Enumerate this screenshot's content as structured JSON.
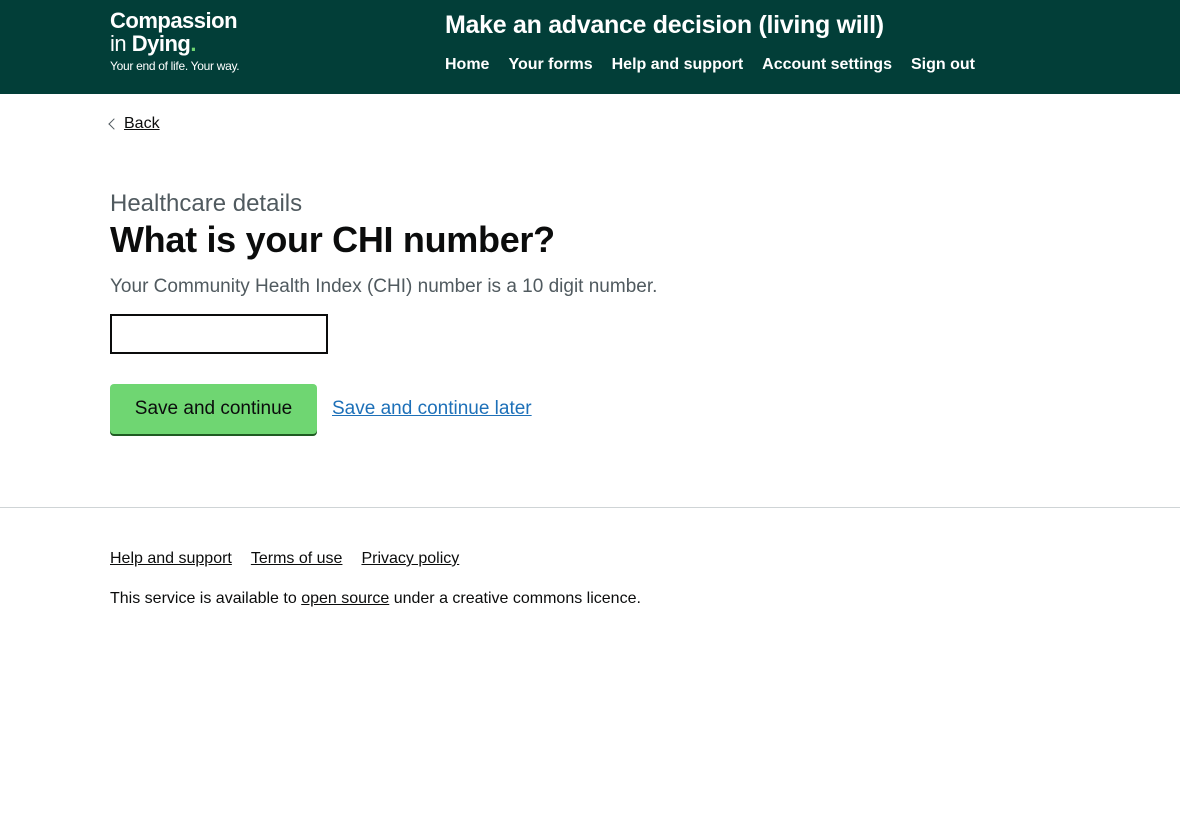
{
  "header": {
    "logo": {
      "line1": "Compassion",
      "line2_prefix": "in",
      "line2_bold": "Dying",
      "line2_dot": ".",
      "tagline": "Your end of life. Your way."
    },
    "service_name": "Make an advance decision (living will)",
    "nav": [
      {
        "label": "Home"
      },
      {
        "label": "Your forms"
      },
      {
        "label": "Help and support"
      },
      {
        "label": "Account settings"
      },
      {
        "label": "Sign out"
      }
    ]
  },
  "back": {
    "label": "Back"
  },
  "question": {
    "caption": "Healthcare details",
    "heading": "What is your CHI number?",
    "hint": "Your Community Health Index (CHI) number is a 10 digit number.",
    "input_value": ""
  },
  "actions": {
    "save_label": "Save and continue",
    "later_label": "Save and continue later"
  },
  "footer": {
    "links": [
      {
        "label": "Help and support"
      },
      {
        "label": "Terms of use"
      },
      {
        "label": "Privacy policy"
      }
    ],
    "licence_prefix": "This service is available to ",
    "licence_link": "open source",
    "licence_suffix": " under a creative commons licence."
  },
  "colors": {
    "header_bg": "#023e38",
    "button_bg": "#6fd672",
    "link": "#1d70b8",
    "hint_text": "#505a5f"
  }
}
